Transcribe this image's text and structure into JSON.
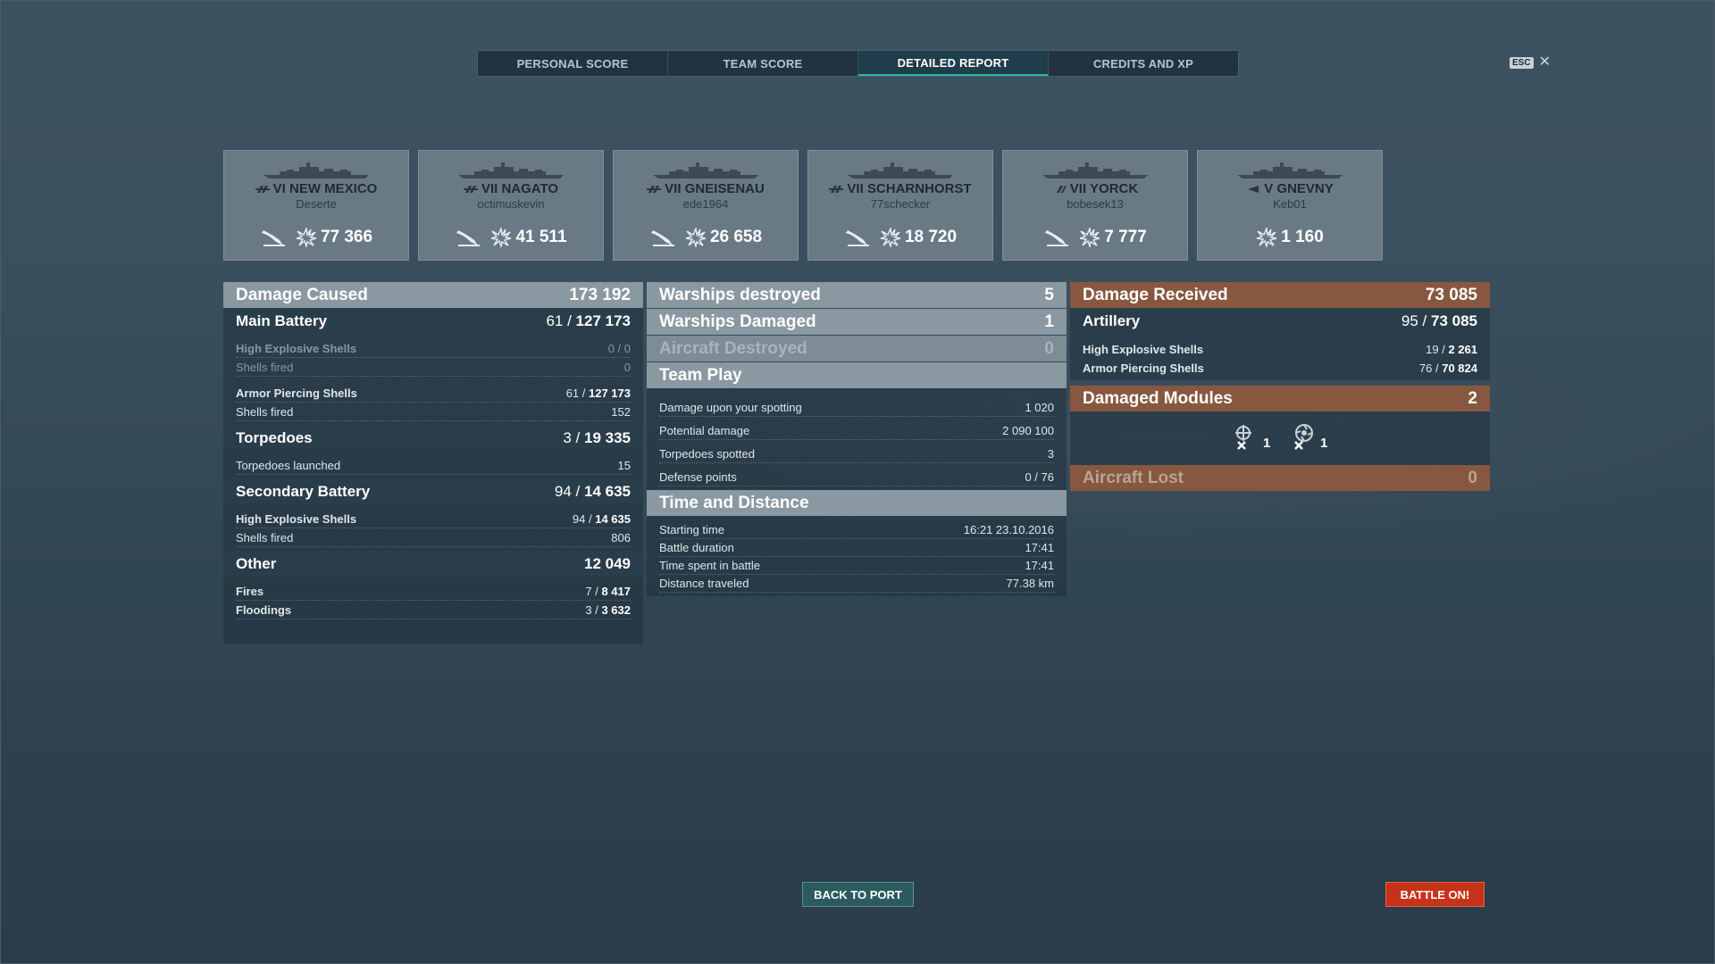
{
  "tabs": [
    {
      "label": "PERSONAL SCORE",
      "active": false
    },
    {
      "label": "TEAM SCORE",
      "active": false
    },
    {
      "label": "DETAILED REPORT",
      "active": true
    },
    {
      "label": "CREDITS AND XP",
      "active": false
    }
  ],
  "close": {
    "key": "ESC",
    "icon": "close-icon"
  },
  "ships": [
    {
      "tier": "VI",
      "name": "NEW MEXICO",
      "title": "VI NEW MEXICO",
      "player": "Deserte",
      "damage": "77 366",
      "class_icon": "battleship-icon",
      "repair_icon": true
    },
    {
      "tier": "VII",
      "name": "NAGATO",
      "title": "VII NAGATO",
      "player": "octimuskevin",
      "damage": "41 511",
      "class_icon": "battleship-icon",
      "repair_icon": true
    },
    {
      "tier": "VII",
      "name": "GNEISENAU",
      "title": "VII GNEISENAU",
      "player": "ede1964",
      "damage": "26 658",
      "class_icon": "battleship-icon",
      "repair_icon": true
    },
    {
      "tier": "VII",
      "name": "SCHARNHORST",
      "title": "VII SCHARNHORST",
      "player": "77schecker",
      "damage": "18 720",
      "class_icon": "battleship-icon",
      "repair_icon": true
    },
    {
      "tier": "VII",
      "name": "YORCK",
      "title": "VII YORCK",
      "player": "bobesek13",
      "damage": "7 777",
      "class_icon": "cruiser-icon",
      "repair_icon": true
    },
    {
      "tier": "V",
      "name": "GNEVNY",
      "title": "V GNEVNY",
      "player": "Keb01",
      "damage": "1 160",
      "class_icon": "destroyer-icon",
      "repair_icon": false
    }
  ],
  "damage_caused": {
    "label": "Damage Caused",
    "total": "173 192",
    "main_battery": {
      "label": "Main Battery",
      "hits": "61",
      "damage": "127 173",
      "he_label": "High Explosive Shells",
      "he_value": "0 / 0",
      "he_fired_label": "Shells fired",
      "he_fired": "0",
      "ap_label": "Armor Piercing Shells",
      "ap_hits": "61",
      "ap_damage": "127 173",
      "ap_fired_label": "Shells fired",
      "ap_fired": "152"
    },
    "torpedoes": {
      "label": "Torpedoes",
      "hits": "3",
      "damage": "19 335",
      "launched_label": "Torpedoes launched",
      "launched": "15"
    },
    "secondary": {
      "label": "Secondary Battery",
      "hits": "94",
      "damage": "14 635",
      "he_label": "High Explosive Shells",
      "he_hits": "94",
      "he_damage": "14 635",
      "fired_label": "Shells fired",
      "fired": "806"
    },
    "other": {
      "label": "Other",
      "total": "12 049",
      "fires_label": "Fires",
      "fires_count": "7",
      "fires_damage": "8 417",
      "floodings_label": "Floodings",
      "floodings_count": "3",
      "floodings_damage": "3 632"
    }
  },
  "middle": {
    "warships_destroyed": {
      "label": "Warships destroyed",
      "value": "5"
    },
    "warships_damaged": {
      "label": "Warships Damaged",
      "value": "1"
    },
    "aircraft_destroyed": {
      "label": "Aircraft Destroyed",
      "value": "0"
    },
    "team_play": {
      "label": "Team Play",
      "rows": [
        {
          "label": "Damage upon your spotting",
          "value": "1 020"
        },
        {
          "label": "Potential damage",
          "value": "2 090 100"
        },
        {
          "label": "Torpedoes spotted",
          "value": "3"
        },
        {
          "label": "Defense points",
          "value": "0 / 76"
        }
      ]
    },
    "time_distance": {
      "label": "Time and Distance",
      "rows": [
        {
          "label": "Starting time",
          "value": "16:21  23.10.2016"
        },
        {
          "label": "Battle duration",
          "value": "17:41"
        },
        {
          "label": "Time spent in battle",
          "value": "17:41"
        },
        {
          "label": "Distance traveled",
          "value": "77.38 km"
        }
      ]
    }
  },
  "damage_received": {
    "label": "Damage Received",
    "total": "73 085",
    "artillery": {
      "label": "Artillery",
      "hits": "95",
      "damage": "73 085",
      "he_label": "High Explosive Shells",
      "he_hits": "19",
      "he_damage": "2 261",
      "ap_label": "Armor Piercing Shells",
      "ap_hits": "76",
      "ap_damage": "70 824"
    },
    "damaged_modules": {
      "label": "Damaged Modules",
      "value": "2",
      "items": [
        {
          "icon": "steering-gear-icon",
          "count": "1"
        },
        {
          "icon": "engine-icon",
          "count": "1"
        }
      ]
    },
    "aircraft_lost": {
      "label": "Aircraft Lost",
      "value": "0"
    }
  },
  "buttons": {
    "back_to_port": "BACK TO PORT",
    "battle_on": "BATTLE ON!"
  },
  "colors": {
    "accent_teal": "#2fb7a8",
    "battle_button": "#c7321a",
    "received_header": "#87583f"
  }
}
